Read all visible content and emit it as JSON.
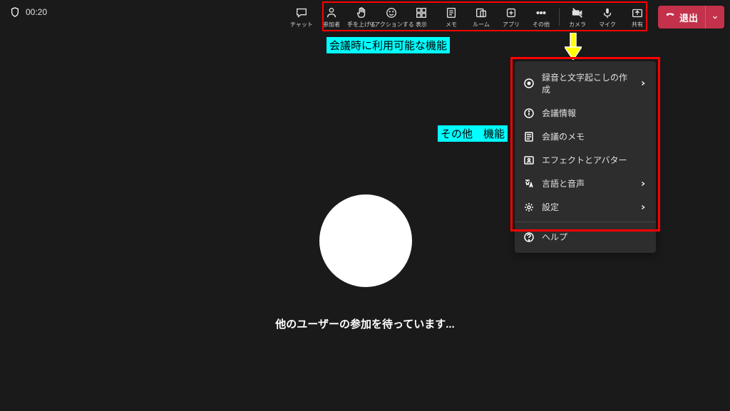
{
  "timer": "00:20",
  "toolbar": {
    "buttons": [
      {
        "label": "チャット",
        "icon": "chat-icon"
      },
      {
        "label": "参加者",
        "icon": "people-icon"
      },
      {
        "label": "手を上げる",
        "icon": "hand-icon"
      },
      {
        "label": "リアクションする",
        "icon": "emoji-icon"
      },
      {
        "label": "表示",
        "icon": "grid-icon"
      },
      {
        "label": "メモ",
        "icon": "note-icon"
      },
      {
        "label": "ルーム",
        "icon": "room-icon"
      },
      {
        "label": "アプリ",
        "icon": "apps-icon"
      },
      {
        "label": "その他",
        "icon": "more-icon"
      }
    ],
    "camera": {
      "label": "カメラ"
    },
    "mic": {
      "label": "マイク"
    },
    "share": {
      "label": "共有"
    },
    "leave": {
      "label": "退出"
    }
  },
  "annotations": {
    "toolbar_label": "会議時に利用可能な機能",
    "menu_label": "その他　機能"
  },
  "waiting_text": "他のユーザーの参加を待っています...",
  "menu": {
    "items": [
      {
        "label": "録音と文字起こしの作成",
        "has_chevron": true
      },
      {
        "label": "会議情報",
        "has_chevron": false
      },
      {
        "label": "会議のメモ",
        "has_chevron": false
      },
      {
        "label": "エフェクトとアバター",
        "has_chevron": false
      },
      {
        "label": "言語と音声",
        "has_chevron": true
      },
      {
        "label": "設定",
        "has_chevron": true
      }
    ],
    "help": {
      "label": "ヘルプ"
    }
  }
}
